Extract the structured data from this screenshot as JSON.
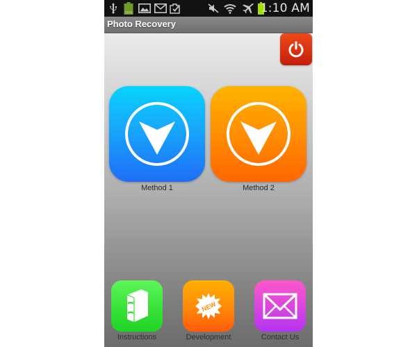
{
  "status_bar": {
    "icons": [
      "usb-icon",
      "battery-full-icon",
      "gallery-icon",
      "gmail-icon",
      "clipboard-check-icon",
      "mute-icon",
      "wifi-icon",
      "airplane-mode-icon",
      "battery-icon"
    ],
    "battery_small_label": "100%",
    "time": "1:10 AM"
  },
  "app_bar": {
    "title": "Photo Recovery"
  },
  "power_button": {
    "icon": "power-icon",
    "color": "#d8300f"
  },
  "methods": [
    {
      "label": "Method 1",
      "icon": "chevron-down-circle-icon",
      "color": "#18a6fb"
    },
    {
      "label": "Method 2",
      "icon": "chevron-down-circle-icon",
      "color": "#ff8e04"
    }
  ],
  "dock": [
    {
      "label": "Instructions",
      "icon": "book-icon",
      "color": "#35e036"
    },
    {
      "label": "Development",
      "icon": "new-badge-icon",
      "badge_text": "NEW",
      "color": "#ff8c08"
    },
    {
      "label": "Contact Us",
      "icon": "mail-icon",
      "color": "#d646e0"
    }
  ]
}
